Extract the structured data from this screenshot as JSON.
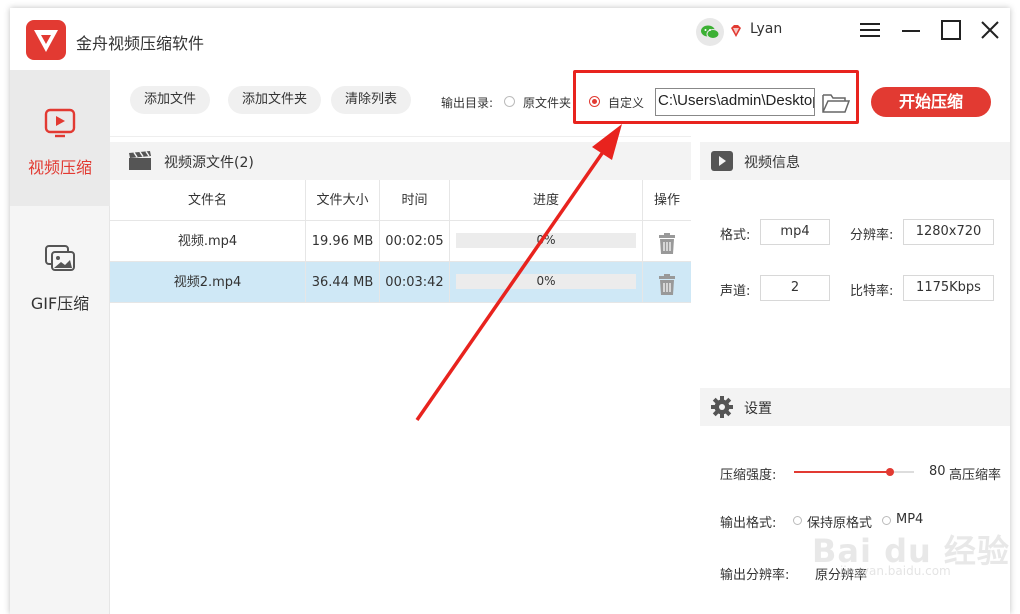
{
  "app": {
    "title": "金舟视频压缩软件",
    "user_name": "Lyan",
    "accent_color": "#e23a32"
  },
  "sidebar": {
    "items": [
      {
        "label": "视频压缩",
        "icon": "video-play-icon",
        "active": true
      },
      {
        "label": "GIF压缩",
        "icon": "gif-image-icon",
        "active": false
      }
    ]
  },
  "toolbar": {
    "add_file_label": "添加文件",
    "add_folder_label": "添加文件夹",
    "clear_list_label": "清除列表",
    "output_dir_label": "输出目录:",
    "option_original_folder": "原文件夹",
    "option_custom": "自定义",
    "selected_option": "自定义",
    "output_path": "C:\\Users\\admin\\Desktop",
    "start_label": "开始压缩"
  },
  "source_panel": {
    "title": "视频源文件(2)",
    "columns": [
      "文件名",
      "文件大小",
      "时间",
      "进度",
      "操作"
    ],
    "rows": [
      {
        "name": "视频.mp4",
        "size": "19.96 MB",
        "time": "00:02:05",
        "progress_text": "0%",
        "progress": 0,
        "selected": false
      },
      {
        "name": "视频2.mp4",
        "size": "36.44 MB",
        "time": "00:03:42",
        "progress_text": "0%",
        "progress": 0,
        "selected": true
      }
    ]
  },
  "video_info": {
    "title": "视频信息",
    "format_label": "格式:",
    "format_value": "mp4",
    "resolution_label": "分辨率:",
    "resolution_value": "1280x720",
    "channels_label": "声道:",
    "channels_value": "2",
    "bitrate_label": "比特率:",
    "bitrate_value": "1175Kbps"
  },
  "settings": {
    "title": "设置",
    "strength_label": "压缩强度:",
    "strength_value": 80,
    "strength_value_text": "80",
    "strength_suffix": "高压缩率",
    "output_format_label": "输出格式:",
    "format_keep": "保持原格式",
    "format_mp4": "MP4",
    "output_res_label": "输出分辨率:",
    "output_res_value": "原分辨率"
  },
  "watermark": {
    "text": "Bai du 经验",
    "url": "jingyan.baidu.com"
  }
}
